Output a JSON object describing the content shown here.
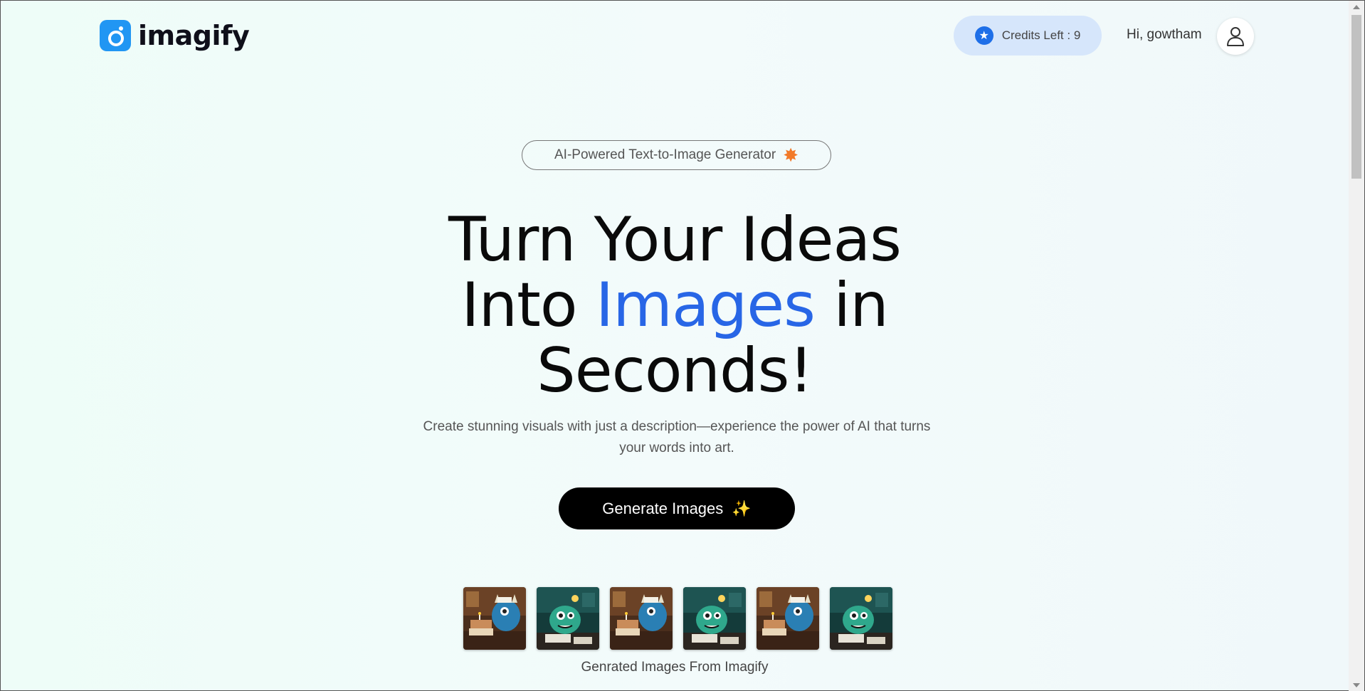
{
  "navbar": {
    "logo_text": "imagify",
    "credits_label": "Credits Left : 9",
    "greeting": "Hi, gowtham"
  },
  "hero": {
    "badge_text": "AI-Powered Text-to-Image Generator",
    "headline_line1": "Turn Your Ideas",
    "headline_into": "Into ",
    "headline_highlight": "Images",
    "headline_in": " in",
    "headline_line3": "Seconds!",
    "subtitle": "Create stunning visuals with just a description—experience the power of AI that turns your words into art.",
    "button_label": "Generate Images",
    "button_icon": "✨",
    "caption": "Genrated Images From Imagify"
  },
  "thumbnails": [
    {
      "scene": "monster-birthday-cake"
    },
    {
      "scene": "monster-with-lamp"
    },
    {
      "scene": "monster-birthday-cake"
    },
    {
      "scene": "monster-with-lamp"
    },
    {
      "scene": "monster-birthday-cake"
    },
    {
      "scene": "monster-with-lamp"
    }
  ],
  "colors": {
    "accent": "#2866e6",
    "credits_bg": "#d6e6fb",
    "button_bg": "#000000"
  }
}
